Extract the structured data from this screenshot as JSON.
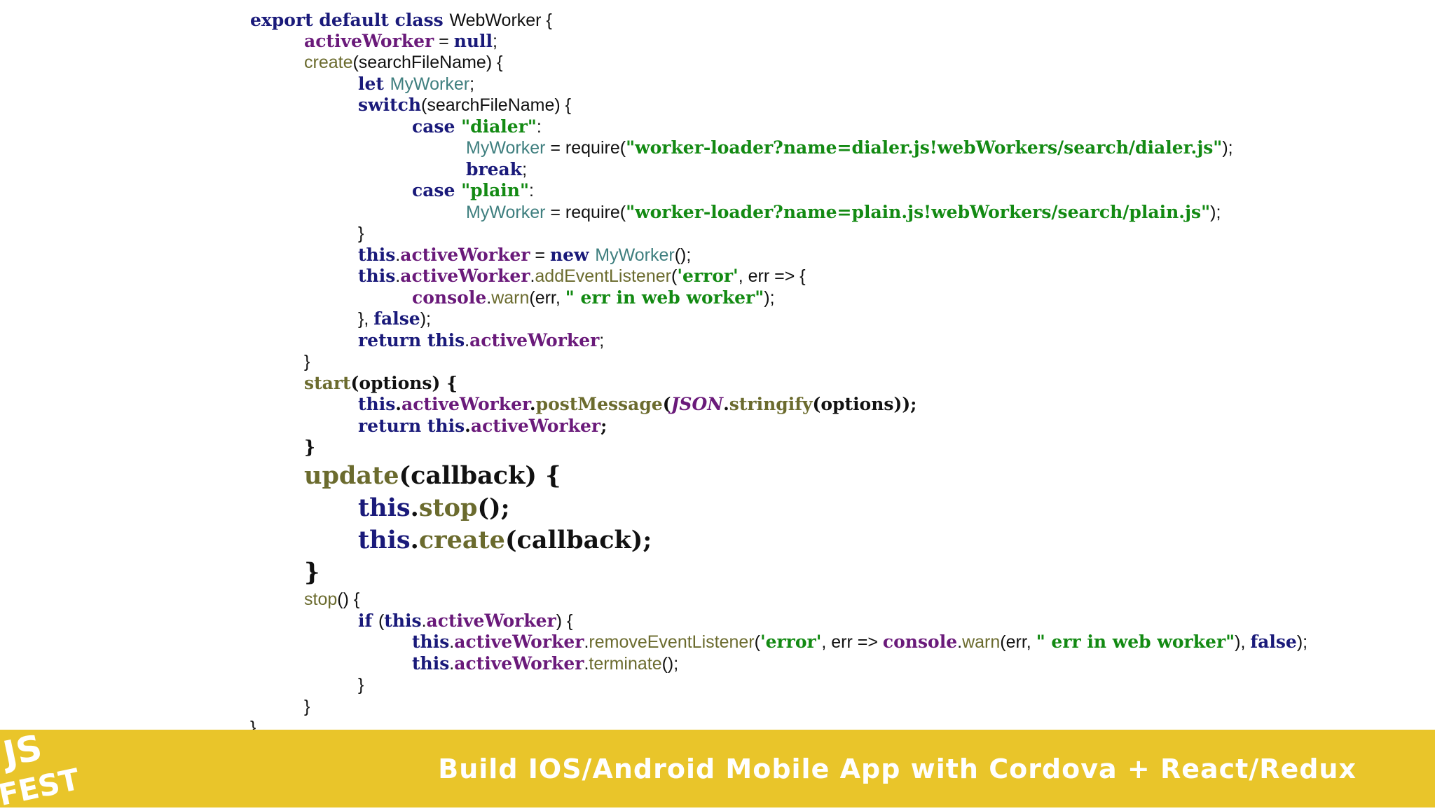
{
  "code_lines": [
    {
      "indent": 0,
      "segments": [
        {
          "text": "export default class ",
          "c": "k"
        },
        {
          "text": "WebWorker {",
          "c": "n"
        }
      ]
    },
    {
      "indent": 1,
      "segments": [
        {
          "text": "activeWorker",
          "c": "p"
        },
        {
          "text": " = ",
          "c": "n"
        },
        {
          "text": "null",
          "c": "k"
        },
        {
          "text": ";",
          "c": "n"
        }
      ]
    },
    {
      "indent": 1,
      "segments": [
        {
          "text": "create",
          "c": "o"
        },
        {
          "text": "(searchFileName) {",
          "c": "n"
        }
      ]
    },
    {
      "indent": 2,
      "segments": [
        {
          "text": "let ",
          "c": "k"
        },
        {
          "text": "MyWorker",
          "c": "t"
        },
        {
          "text": ";",
          "c": "n"
        }
      ]
    },
    {
      "indent": 2,
      "segments": [
        {
          "text": "switch",
          "c": "k"
        },
        {
          "text": "(searchFileName) {",
          "c": "n"
        }
      ]
    },
    {
      "indent": 3,
      "segments": [
        {
          "text": "case ",
          "c": "k"
        },
        {
          "text": "\"dialer\"",
          "c": "s"
        },
        {
          "text": ":",
          "c": "n"
        }
      ]
    },
    {
      "indent": 4,
      "segments": [
        {
          "text": "MyWorker",
          "c": "t"
        },
        {
          "text": " = require(",
          "c": "n"
        },
        {
          "text": "\"worker-loader?name=dialer.js!webWorkers/search/dialer.js\"",
          "c": "s"
        },
        {
          "text": ");",
          "c": "n"
        }
      ]
    },
    {
      "indent": 4,
      "segments": [
        {
          "text": "break",
          "c": "k"
        },
        {
          "text": ";",
          "c": "n"
        }
      ]
    },
    {
      "indent": 3,
      "segments": [
        {
          "text": "case ",
          "c": "k"
        },
        {
          "text": "\"plain\"",
          "c": "s"
        },
        {
          "text": ":",
          "c": "n"
        }
      ]
    },
    {
      "indent": 4,
      "segments": [
        {
          "text": "MyWorker",
          "c": "t"
        },
        {
          "text": " = require(",
          "c": "n"
        },
        {
          "text": "\"worker-loader?name=plain.js!webWorkers/search/plain.js\"",
          "c": "s"
        },
        {
          "text": ");",
          "c": "n"
        }
      ]
    },
    {
      "indent": 2,
      "segments": [
        {
          "text": "}",
          "c": "n"
        }
      ]
    },
    {
      "indent": 2,
      "segments": [
        {
          "text": "this",
          "c": "k"
        },
        {
          "text": ".",
          "c": "n"
        },
        {
          "text": "activeWorker",
          "c": "p"
        },
        {
          "text": " = ",
          "c": "n"
        },
        {
          "text": "new ",
          "c": "k"
        },
        {
          "text": "MyWorker",
          "c": "t"
        },
        {
          "text": "();",
          "c": "n"
        }
      ]
    },
    {
      "indent": 2,
      "segments": [
        {
          "text": "this",
          "c": "k"
        },
        {
          "text": ".",
          "c": "n"
        },
        {
          "text": "activeWorker",
          "c": "p"
        },
        {
          "text": ".",
          "c": "n"
        },
        {
          "text": "addEventListener",
          "c": "o"
        },
        {
          "text": "(",
          "c": "n"
        },
        {
          "text": "'error'",
          "c": "s"
        },
        {
          "text": ", err => {",
          "c": "n"
        }
      ]
    },
    {
      "indent": 3,
      "segments": [
        {
          "text": "console",
          "c": "p"
        },
        {
          "text": ".",
          "c": "n"
        },
        {
          "text": "warn",
          "c": "o"
        },
        {
          "text": "(err, ",
          "c": "n"
        },
        {
          "text": "\" err in web worker\"",
          "c": "s"
        },
        {
          "text": ");",
          "c": "n"
        }
      ]
    },
    {
      "indent": 2,
      "segments": [
        {
          "text": "}, ",
          "c": "n"
        },
        {
          "text": "false",
          "c": "k"
        },
        {
          "text": ");",
          "c": "n"
        }
      ]
    },
    {
      "indent": 2,
      "segments": [
        {
          "text": "return ",
          "c": "k"
        },
        {
          "text": "this",
          "c": "k"
        },
        {
          "text": ".",
          "c": "n"
        },
        {
          "text": "activeWorker",
          "c": "p"
        },
        {
          "text": ";",
          "c": "n"
        }
      ]
    },
    {
      "indent": 1,
      "segments": [
        {
          "text": "}",
          "c": "n"
        }
      ]
    },
    {
      "indent": 1,
      "segments": [
        {
          "text": "start",
          "c": "ob"
        },
        {
          "text": "(options) {",
          "c": "b"
        }
      ]
    },
    {
      "indent": 2,
      "segments": [
        {
          "text": "this",
          "c": "k"
        },
        {
          "text": ".",
          "c": "b"
        },
        {
          "text": "activeWorker",
          "c": "p"
        },
        {
          "text": ".",
          "c": "b"
        },
        {
          "text": "postMessage",
          "c": "ob"
        },
        {
          "text": "(",
          "c": "b"
        },
        {
          "text": "JSON",
          "c": "bi"
        },
        {
          "text": ".",
          "c": "b"
        },
        {
          "text": "stringify",
          "c": "ob"
        },
        {
          "text": "(options));",
          "c": "b"
        }
      ]
    },
    {
      "indent": 2,
      "segments": [
        {
          "text": "return ",
          "c": "k"
        },
        {
          "text": "this",
          "c": "k"
        },
        {
          "text": ".",
          "c": "b"
        },
        {
          "text": "activeWorker",
          "c": "p"
        },
        {
          "text": ";",
          "c": "b"
        }
      ]
    },
    {
      "indent": 1,
      "segments": [
        {
          "text": "}",
          "c": "b"
        }
      ]
    },
    {
      "indent": 1,
      "big": true,
      "segments": [
        {
          "text": "update",
          "c": "ob"
        },
        {
          "text": "(callback) {",
          "c": "b"
        }
      ]
    },
    {
      "indent": 2,
      "big": true,
      "segments": [
        {
          "text": "this",
          "c": "k"
        },
        {
          "text": ".",
          "c": "b"
        },
        {
          "text": "stop",
          "c": "ob"
        },
        {
          "text": "();",
          "c": "b"
        }
      ]
    },
    {
      "indent": 2,
      "big": true,
      "segments": [
        {
          "text": "this",
          "c": "k"
        },
        {
          "text": ".",
          "c": "b"
        },
        {
          "text": "create",
          "c": "ob"
        },
        {
          "text": "(callback);",
          "c": "b"
        }
      ]
    },
    {
      "indent": 1,
      "big": true,
      "segments": [
        {
          "text": "}",
          "c": "b"
        }
      ]
    },
    {
      "indent": 1,
      "segments": [
        {
          "text": "stop",
          "c": "o"
        },
        {
          "text": "() {",
          "c": "n"
        }
      ]
    },
    {
      "indent": 2,
      "segments": [
        {
          "text": "if ",
          "c": "k"
        },
        {
          "text": "(",
          "c": "n"
        },
        {
          "text": "this",
          "c": "k"
        },
        {
          "text": ".",
          "c": "n"
        },
        {
          "text": "activeWorker",
          "c": "p"
        },
        {
          "text": ") {",
          "c": "n"
        }
      ]
    },
    {
      "indent": 3,
      "segments": [
        {
          "text": "this",
          "c": "k"
        },
        {
          "text": ".",
          "c": "n"
        },
        {
          "text": "activeWorker",
          "c": "p"
        },
        {
          "text": ".",
          "c": "n"
        },
        {
          "text": "removeEventListener",
          "c": "o"
        },
        {
          "text": "(",
          "c": "n"
        },
        {
          "text": "'error'",
          "c": "s"
        },
        {
          "text": ", err => ",
          "c": "n"
        },
        {
          "text": "console",
          "c": "p"
        },
        {
          "text": ".",
          "c": "n"
        },
        {
          "text": "warn",
          "c": "o"
        },
        {
          "text": "(err, ",
          "c": "n"
        },
        {
          "text": "\" err in web worker\"",
          "c": "s"
        },
        {
          "text": "), ",
          "c": "n"
        },
        {
          "text": "false",
          "c": "k"
        },
        {
          "text": ");",
          "c": "n"
        }
      ]
    },
    {
      "indent": 3,
      "segments": [
        {
          "text": "this",
          "c": "k"
        },
        {
          "text": ".",
          "c": "n"
        },
        {
          "text": "activeWorker",
          "c": "p"
        },
        {
          "text": ".",
          "c": "n"
        },
        {
          "text": "terminate",
          "c": "o"
        },
        {
          "text": "();",
          "c": "n"
        }
      ]
    },
    {
      "indent": 2,
      "segments": [
        {
          "text": "}",
          "c": "n"
        }
      ]
    },
    {
      "indent": 1,
      "segments": [
        {
          "text": "}",
          "c": "n"
        }
      ]
    },
    {
      "indent": 0,
      "segments": [
        {
          "text": "}",
          "c": "n"
        }
      ]
    }
  ],
  "footer": {
    "title": "Build IOS/Android Mobile App with Cordova + React/Redux",
    "logo_text_top": "JS",
    "logo_text_bottom": "FEST",
    "background_color": "#e9c52a",
    "text_color": "#ffffff"
  },
  "colors": {
    "keyword": "#1a1a7a",
    "property": "#6a1a7a",
    "string": "#138a13",
    "type": "#3f7f7f",
    "method": "#6b6b2e",
    "text": "#111111"
  }
}
